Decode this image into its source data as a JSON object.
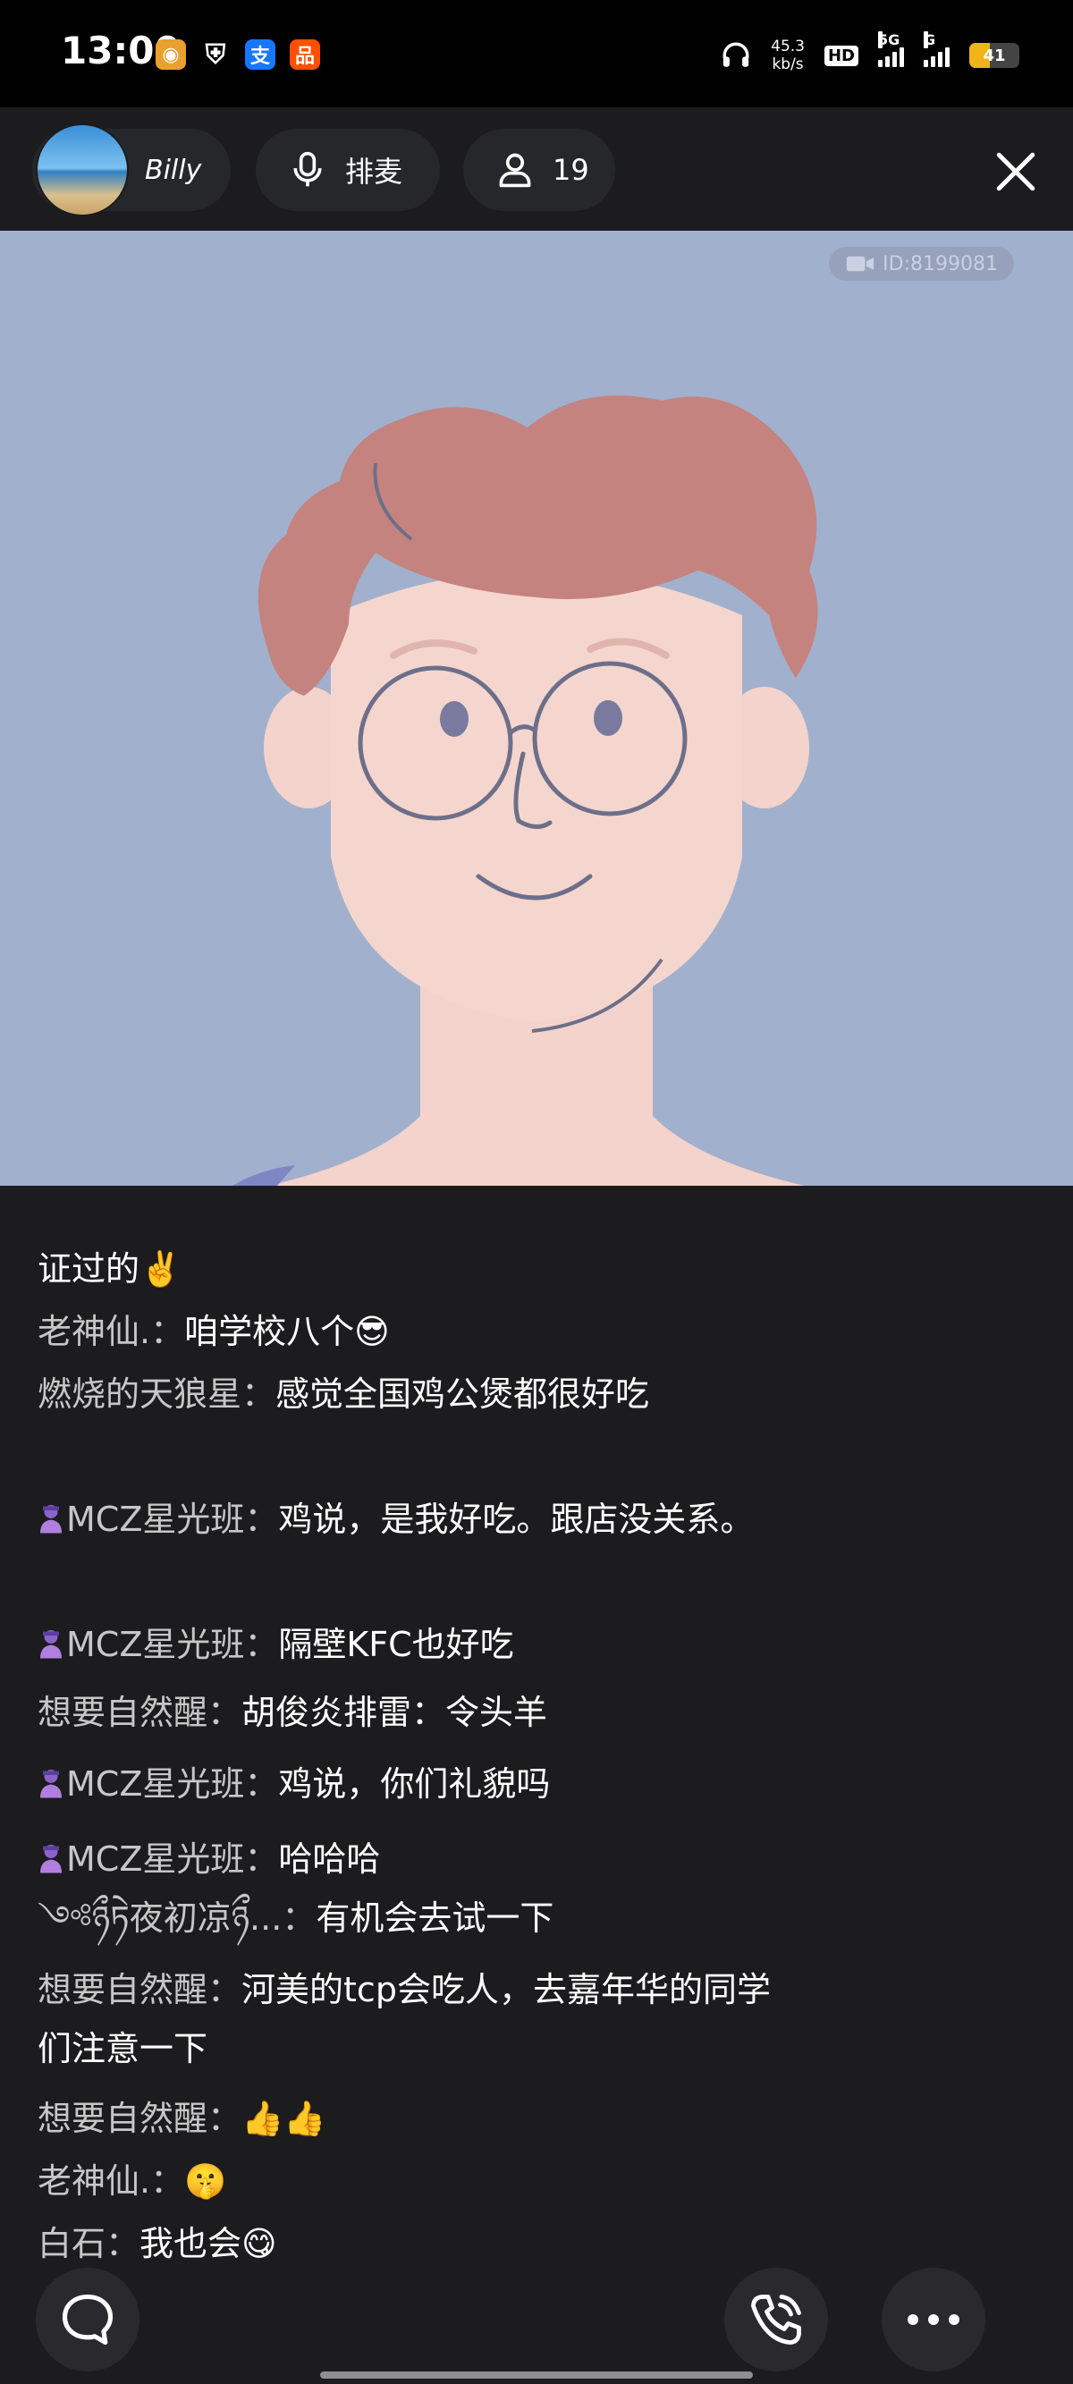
{
  "status_bar": {
    "time": "13:00",
    "net_speed_value": "45.3",
    "net_speed_unit": "kb/s",
    "hd_label": "HD",
    "signal_1_tag": "5G",
    "signal_2_tag": "G",
    "battery_level": "41",
    "battery_fraction": 0.41,
    "app_icons": [
      "camera-app-icon",
      "shield-app-icon",
      "alipay-app-icon",
      "taobao-app-icon"
    ]
  },
  "room_header": {
    "host_name": "Billy",
    "queue_label": "排麦",
    "member_count": "19"
  },
  "video": {
    "room_id": "ID:8199081"
  },
  "chat": {
    "messages": [
      {
        "user": "",
        "sep": "",
        "text": "证过的",
        "emoji": "✌️"
      },
      {
        "user": "老神仙.",
        "sep": "：",
        "text": "咱学校八个",
        "emoji": "😎"
      },
      {
        "user": "燃烧的天狼星",
        "sep": "：",
        "text": "感觉全国鸡公煲都很好吃",
        "emoji": ""
      },
      {
        "user": "MCZ星光班",
        "sep": "：",
        "text": "鸡说，是我好吃。跟店没关系。",
        "emoji": "",
        "badge": true
      },
      {
        "user": "MCZ星光班",
        "sep": "：",
        "text": "隔壁KFC也好吃",
        "emoji": "",
        "badge": true
      },
      {
        "user": "想要自然醒",
        "sep": "：",
        "text": "胡俊炎排雷：令头羊",
        "emoji": ""
      },
      {
        "user": "MCZ星光班",
        "sep": "：",
        "text": "鸡说，你们礼貌吗",
        "emoji": "",
        "badge": true
      },
      {
        "user": "MCZ星光班",
        "sep": "：",
        "text": "哈哈哈",
        "emoji": "",
        "badge": true
      },
      {
        "user": "༺ཉྀཏེ夜初凉ཉྀ...",
        "sep": "：",
        "text": "有机会去试一下",
        "emoji": ""
      },
      {
        "user": "想要自然醒",
        "sep": "：",
        "text": "河美的tcp会吃人，去嘉年华的同学们注意一下",
        "emoji": ""
      },
      {
        "user": "想要自然醒",
        "sep": "：",
        "text": "",
        "emoji": "👍👍"
      },
      {
        "user": "老神仙.",
        "sep": "：",
        "text": "",
        "emoji": "🤫"
      },
      {
        "user": "白石",
        "sep": "：",
        "text": "我也会",
        "emoji": "😋"
      }
    ]
  },
  "icons": {
    "chat": "chat-bubble-icon",
    "call": "phone-call-icon",
    "more": "more-dots-icon",
    "mic": "mic-icon",
    "person": "person-icon",
    "close": "close-icon",
    "video_camera": "video-camera-icon"
  },
  "colors": {
    "background": "#1c1c1e",
    "video_bg": "#a1b0cd",
    "hair": "#c4837f",
    "skin": "#f3d3cb",
    "battery": "#f1b319"
  }
}
